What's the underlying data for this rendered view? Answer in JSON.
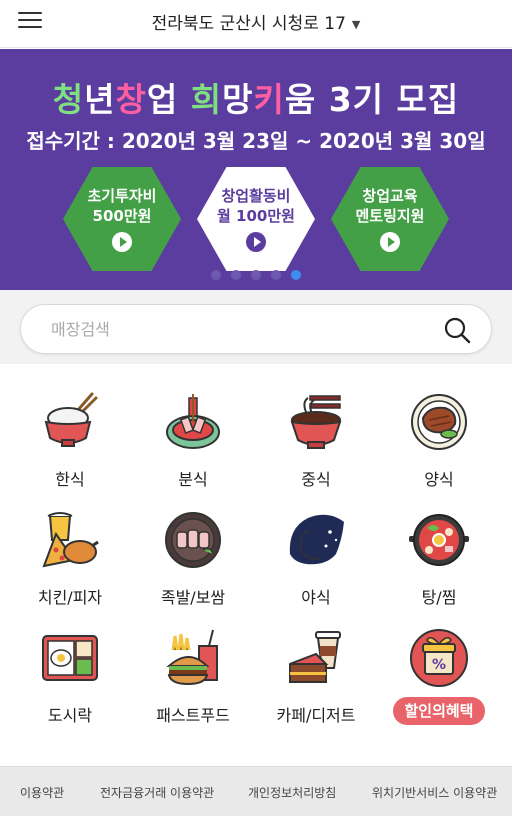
{
  "header": {
    "location": "전라북도 군산시 시청로 17"
  },
  "banner": {
    "title_parts": [
      {
        "text": "청",
        "color": "#7ee081"
      },
      {
        "text": "년",
        "color": "#ffffff"
      },
      {
        "text": "창",
        "color": "#ff5fa2"
      },
      {
        "text": "업 ",
        "color": "#ffffff"
      },
      {
        "text": "희",
        "color": "#7ee081"
      },
      {
        "text": "망",
        "color": "#ffffff"
      },
      {
        "text": "키",
        "color": "#ff5fa2"
      },
      {
        "text": "움 3기 모집",
        "color": "#ffffff"
      }
    ],
    "subtitle": "접수기간 : 2020년 3월 23일 ~ 2020년 3월 30일",
    "badges": [
      {
        "line1": "초기투자비",
        "line2": "500만원",
        "style": "green"
      },
      {
        "line1": "창업활동비",
        "line2": "월 100만원",
        "style": "white"
      },
      {
        "line1": "창업교육",
        "line2": "멘토링지원",
        "style": "green"
      }
    ],
    "slides_total": 5,
    "active_slide": 5
  },
  "search": {
    "placeholder": "매장검색"
  },
  "categories": [
    {
      "label": "한식",
      "icon": "rice-bowl-icon"
    },
    {
      "label": "분식",
      "icon": "tteokbokki-icon"
    },
    {
      "label": "중식",
      "icon": "noodle-bowl-icon"
    },
    {
      "label": "양식",
      "icon": "steak-plate-icon"
    },
    {
      "label": "치킨/피자",
      "icon": "chicken-pizza-icon"
    },
    {
      "label": "족발/보쌈",
      "icon": "jokbal-plate-icon"
    },
    {
      "label": "야식",
      "icon": "night-moon-icon"
    },
    {
      "label": "탕/찜",
      "icon": "stew-pot-icon"
    },
    {
      "label": "도시락",
      "icon": "lunchbox-icon"
    },
    {
      "label": "패스트푸드",
      "icon": "burger-icon"
    },
    {
      "label": "카페/디저트",
      "icon": "coffee-cake-icon"
    },
    {
      "label": "할인의혜택",
      "icon": "discount-gift-icon"
    }
  ],
  "footer": {
    "links": [
      "이용약관",
      "전자금융거래 이용약관",
      "개인정보처리방침",
      "위치기반서비스 이용약관"
    ]
  },
  "colors": {
    "banner_bg": "#5a3d9e",
    "badge_green": "#43a047",
    "discount_pill": "#e8636a",
    "active_dot": "#3d8cf0"
  }
}
